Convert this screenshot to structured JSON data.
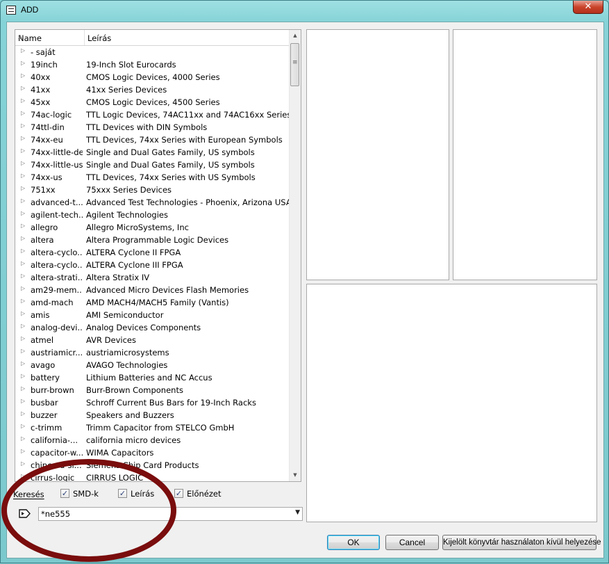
{
  "window": {
    "title": "ADD",
    "close_glyph": "✕"
  },
  "tree": {
    "columns": {
      "name": "Name",
      "description": "Leírás"
    },
    "rows": [
      {
        "name": "- saját",
        "description": ""
      },
      {
        "name": "19inch",
        "description": "19-Inch Slot Eurocards"
      },
      {
        "name": "40xx",
        "description": "CMOS Logic Devices, 4000 Series"
      },
      {
        "name": "41xx",
        "description": "41xx Series Devices"
      },
      {
        "name": "45xx",
        "description": "CMOS Logic Devices, 4500 Series"
      },
      {
        "name": "74ac-logic",
        "description": "TTL Logic Devices, 74AC11xx and 74AC16xx Series"
      },
      {
        "name": "74ttl-din",
        "description": "TTL Devices with DIN Symbols"
      },
      {
        "name": "74xx-eu",
        "description": "TTL Devices, 74xx Series with European Symbols"
      },
      {
        "name": "74xx-little-de",
        "description": "Single and Dual Gates Family, US symbols"
      },
      {
        "name": "74xx-little-us",
        "description": "Single and Dual Gates Family, US symbols"
      },
      {
        "name": "74xx-us",
        "description": "TTL Devices, 74xx Series with US Symbols"
      },
      {
        "name": "751xx",
        "description": "75xxx Series Devices"
      },
      {
        "name": "advanced-t...",
        "description": "Advanced Test Technologies - Phoenix, Arizona USA"
      },
      {
        "name": "agilent-tech...",
        "description": "Agilent Technologies"
      },
      {
        "name": "allegro",
        "description": "Allegro MicroSystems, Inc"
      },
      {
        "name": "altera",
        "description": "Altera Programmable Logic Devices"
      },
      {
        "name": "altera-cyclo...",
        "description": "ALTERA Cyclone II FPGA"
      },
      {
        "name": "altera-cyclo...",
        "description": "ALTERA Cyclone III FPGA"
      },
      {
        "name": "altera-strati...",
        "description": "Altera Stratix IV"
      },
      {
        "name": "am29-mem...",
        "description": "Advanced Micro Devices Flash Memories"
      },
      {
        "name": "amd-mach",
        "description": "AMD MACH4/MACH5 Family (Vantis)"
      },
      {
        "name": "amis",
        "description": "AMI Semiconductor"
      },
      {
        "name": "analog-devi...",
        "description": "Analog Devices Components"
      },
      {
        "name": "atmel",
        "description": "AVR Devices"
      },
      {
        "name": "austriamicr...",
        "description": "austriamicrosystems"
      },
      {
        "name": "avago",
        "description": "AVAGO Technologies"
      },
      {
        "name": "battery",
        "description": "Lithium Batteries and NC Accus"
      },
      {
        "name": "burr-brown",
        "description": "Burr-Brown Components"
      },
      {
        "name": "busbar",
        "description": "Schroff Current Bus Bars for 19-Inch Racks"
      },
      {
        "name": "buzzer",
        "description": "Speakers and Buzzers"
      },
      {
        "name": "c-trimm",
        "description": "Trimm Capacitor from STELCO GmbH"
      },
      {
        "name": "california-...",
        "description": "california micro devices"
      },
      {
        "name": "capacitor-w...",
        "description": "WIMA Capacitors"
      },
      {
        "name": "chipcard-si...",
        "description": "Siemens Chip Card Products"
      },
      {
        "name": "cirrus-logic",
        "description": "CIRRUS LOGIC"
      }
    ]
  },
  "search": {
    "label": "Keresés",
    "options": [
      {
        "label": "SMD-k",
        "checked": true
      },
      {
        "label": "Leírás",
        "checked": true
      },
      {
        "label": "Előnézet",
        "checked": true
      }
    ],
    "value": "*ne555"
  },
  "buttons": {
    "ok": "OK",
    "cancel": "Cancel",
    "exclude": "Kijelölt könyvtár használaton kívül helyezése"
  },
  "colors": {
    "annotation": "#7a0d0d",
    "titlebar": "#86d3d7"
  }
}
